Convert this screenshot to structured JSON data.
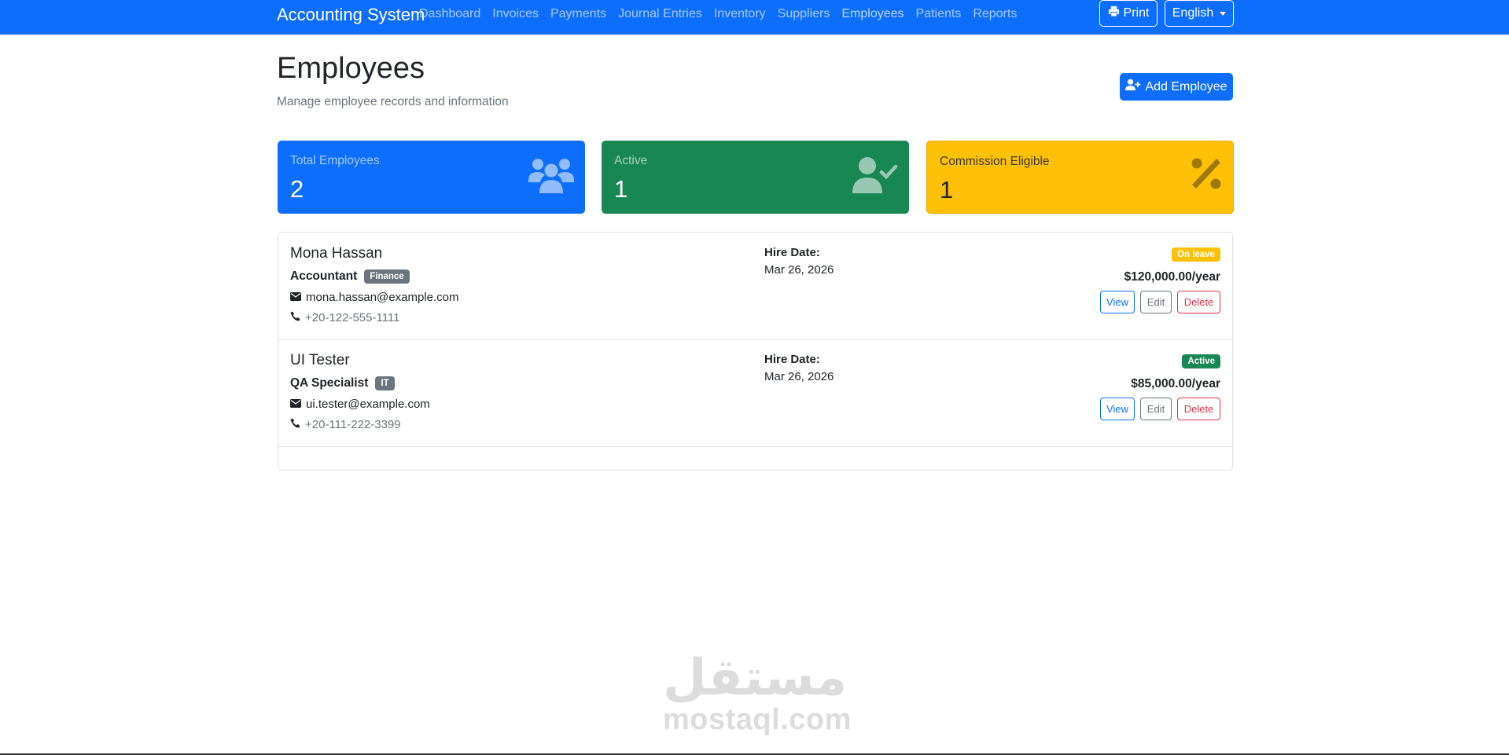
{
  "navbar": {
    "brand": "Accounting System",
    "links": [
      "Dashboard",
      "Invoices",
      "Payments",
      "Journal Entries",
      "Inventory",
      "Suppliers",
      "Employees",
      "Patients",
      "Reports"
    ],
    "print_label": "Print",
    "language_label": "English"
  },
  "header": {
    "title": "Employees",
    "subtitle": "Manage employee records and information",
    "add_button_label": "Add Employee"
  },
  "stats": {
    "total": {
      "label": "Total Employees",
      "value": "2"
    },
    "active": {
      "label": "Active",
      "value": "1"
    },
    "commission": {
      "label": "Commission Eligible",
      "value": "1"
    }
  },
  "employees": [
    {
      "name": "Mona Hassan",
      "role": "Accountant",
      "department": "Finance",
      "email": "mona.hassan@example.com",
      "phone": "+20-122-555-1111",
      "hire_label": "Hire Date:",
      "hire_date": "Mar 26, 2026",
      "status": "On leave",
      "salary": "$120,000.00/year",
      "view_label": "View",
      "edit_label": "Edit",
      "delete_label": "Delete"
    },
    {
      "name": "UI Tester",
      "role": "QA Specialist",
      "department": "IT",
      "email": "ui.tester@example.com",
      "phone": "+20-111-222-3399",
      "hire_label": "Hire Date:",
      "hire_date": "Mar 26, 2026",
      "status": "Active",
      "salary": "$85,000.00/year",
      "view_label": "View",
      "edit_label": "Edit",
      "delete_label": "Delete"
    }
  ],
  "watermark": {
    "arabic": "مستقل",
    "latin": "mostaql.com"
  },
  "colors": {
    "primary": "#0d6efd",
    "success": "#198754",
    "warning": "#ffc107",
    "danger": "#dc3545",
    "secondary": "#6c757d"
  }
}
